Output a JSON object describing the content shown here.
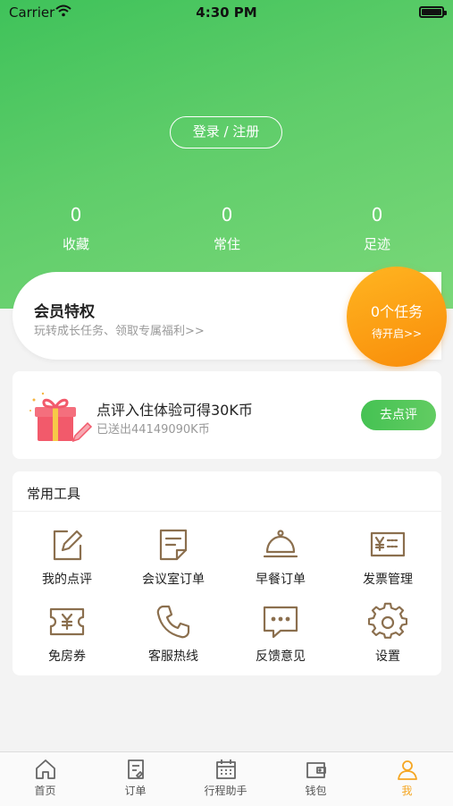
{
  "status": {
    "carrier": "Carrier",
    "time": "4:30 PM"
  },
  "header": {
    "login_label": "登录 / 注册"
  },
  "stats": [
    {
      "value": "0",
      "label": "收藏"
    },
    {
      "value": "0",
      "label": "常住"
    },
    {
      "value": "0",
      "label": "足迹"
    }
  ],
  "member": {
    "title": "会员特权",
    "subtitle": "玩转成长任务、领取专属福利>>",
    "task_count": "0个任务",
    "task_status": "待开启>>"
  },
  "review": {
    "title": "点评入住体验可得30K币",
    "subtitle": "已送出44149090K币",
    "button": "去点评"
  },
  "tools": {
    "title": "常用工具",
    "items": [
      {
        "label": "我的点评",
        "icon": "edit-icon"
      },
      {
        "label": "会议室订单",
        "icon": "document-icon"
      },
      {
        "label": "早餐订单",
        "icon": "cloche-icon"
      },
      {
        "label": "发票管理",
        "icon": "invoice-icon"
      },
      {
        "label": "免房券",
        "icon": "ticket-icon"
      },
      {
        "label": "客服热线",
        "icon": "phone-icon"
      },
      {
        "label": "反馈意见",
        "icon": "chat-icon"
      },
      {
        "label": "设置",
        "icon": "gear-icon"
      }
    ]
  },
  "tabbar": {
    "items": [
      {
        "label": "首页",
        "icon": "home-icon"
      },
      {
        "label": "订单",
        "icon": "order-icon"
      },
      {
        "label": "行程助手",
        "icon": "calendar-icon"
      },
      {
        "label": "钱包",
        "icon": "wallet-icon"
      },
      {
        "label": "我",
        "icon": "user-icon"
      }
    ],
    "active": "我"
  },
  "colors": {
    "accent_green": "#4cc35b",
    "accent_orange": "#f98c09",
    "tab_active": "#f5a623",
    "icon_brown": "#8b6f4e"
  }
}
